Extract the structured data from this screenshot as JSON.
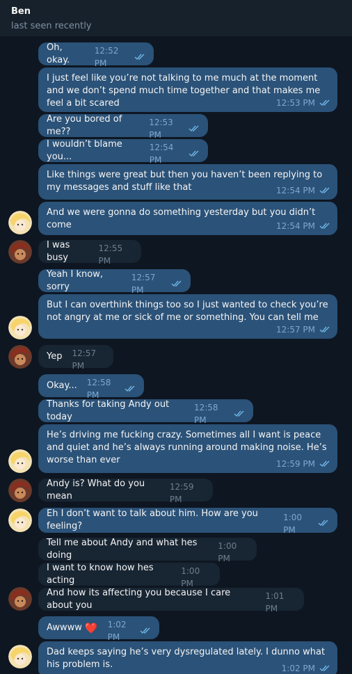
{
  "chat": {
    "contact_name": "Ben",
    "contact_status": "last seen recently"
  },
  "messages": [
    {
      "text": "Oh, okay.",
      "time": "12:52 PM",
      "dir": "out"
    },
    {
      "text": "I just feel like you’re not talking to me much at the moment and we don’t spend much time together and that makes me feel a bit scared",
      "time": "12:53 PM",
      "dir": "out"
    },
    {
      "text": "Are you bored of me??",
      "time": "12:53 PM",
      "dir": "out"
    },
    {
      "text": "I wouldn’t blame you...",
      "time": "12:54 PM",
      "dir": "out"
    },
    {
      "text": "Like things were great but then you haven’t been replying to my messages and stuff like that",
      "time": "12:54 PM",
      "dir": "out"
    },
    {
      "text": "And we were gonna do something yesterday but you didn’t come",
      "time": "12:54 PM",
      "dir": "out"
    },
    {
      "text": "I was busy",
      "time": "12:55 PM",
      "dir": "in"
    },
    {
      "text": "Yeah I know, sorry",
      "time": "12:57 PM",
      "dir": "out"
    },
    {
      "text": "But I can overthink things too so I just wanted to check you’re not angry at me or sick of me or something. You can tell me",
      "time": "12:57 PM",
      "dir": "out"
    },
    {
      "text": "Yep",
      "time": "12:57 PM",
      "dir": "in"
    },
    {
      "text": "Okay...",
      "time": "12:58 PM",
      "dir": "out"
    },
    {
      "text": "Thanks for taking Andy out today",
      "time": "12:58 PM",
      "dir": "out"
    },
    {
      "text": "He’s driving me fucking crazy. Sometimes all I want is peace and quiet and he’s always running around making noise. He’s worse than ever",
      "time": "12:59 PM",
      "dir": "out"
    },
    {
      "text": "Andy is? What do you mean",
      "time": "12:59 PM",
      "dir": "in"
    },
    {
      "text": "Eh I don’t want to talk about him. How are you feeling?",
      "time": "1:00 PM",
      "dir": "out"
    },
    {
      "text": "Tell me about Andy and what hes doing",
      "time": "1:00 PM",
      "dir": "in"
    },
    {
      "text": "I want to know how hes acting",
      "time": "1:00 PM",
      "dir": "in"
    },
    {
      "text": "And how its affecting you because I care about you",
      "time": "1:01 PM",
      "dir": "in"
    },
    {
      "text": "Awwww",
      "emoji": "❤️",
      "time": "1:02 PM",
      "dir": "out"
    },
    {
      "text": "Dad keeps saying he’s very dysregulated lately. I dunno what his problem is.",
      "time": "1:02 PM",
      "dir": "out"
    }
  ],
  "avatars": [
    {
      "kind": "blonde"
    },
    {
      "kind": "brown"
    },
    {
      "kind": "blonde"
    },
    {
      "kind": "brown"
    },
    {
      "kind": "blonde"
    },
    {
      "kind": "brown"
    },
    {
      "kind": "blonde"
    },
    {
      "kind": "brown"
    },
    {
      "kind": "blonde"
    }
  ],
  "colors": {
    "background": "#0e1621",
    "header": "#17212b",
    "outgoing_bubble": "#2b5278",
    "incoming_bubble": "#182533",
    "read_ticks": "#6fb6e8"
  }
}
